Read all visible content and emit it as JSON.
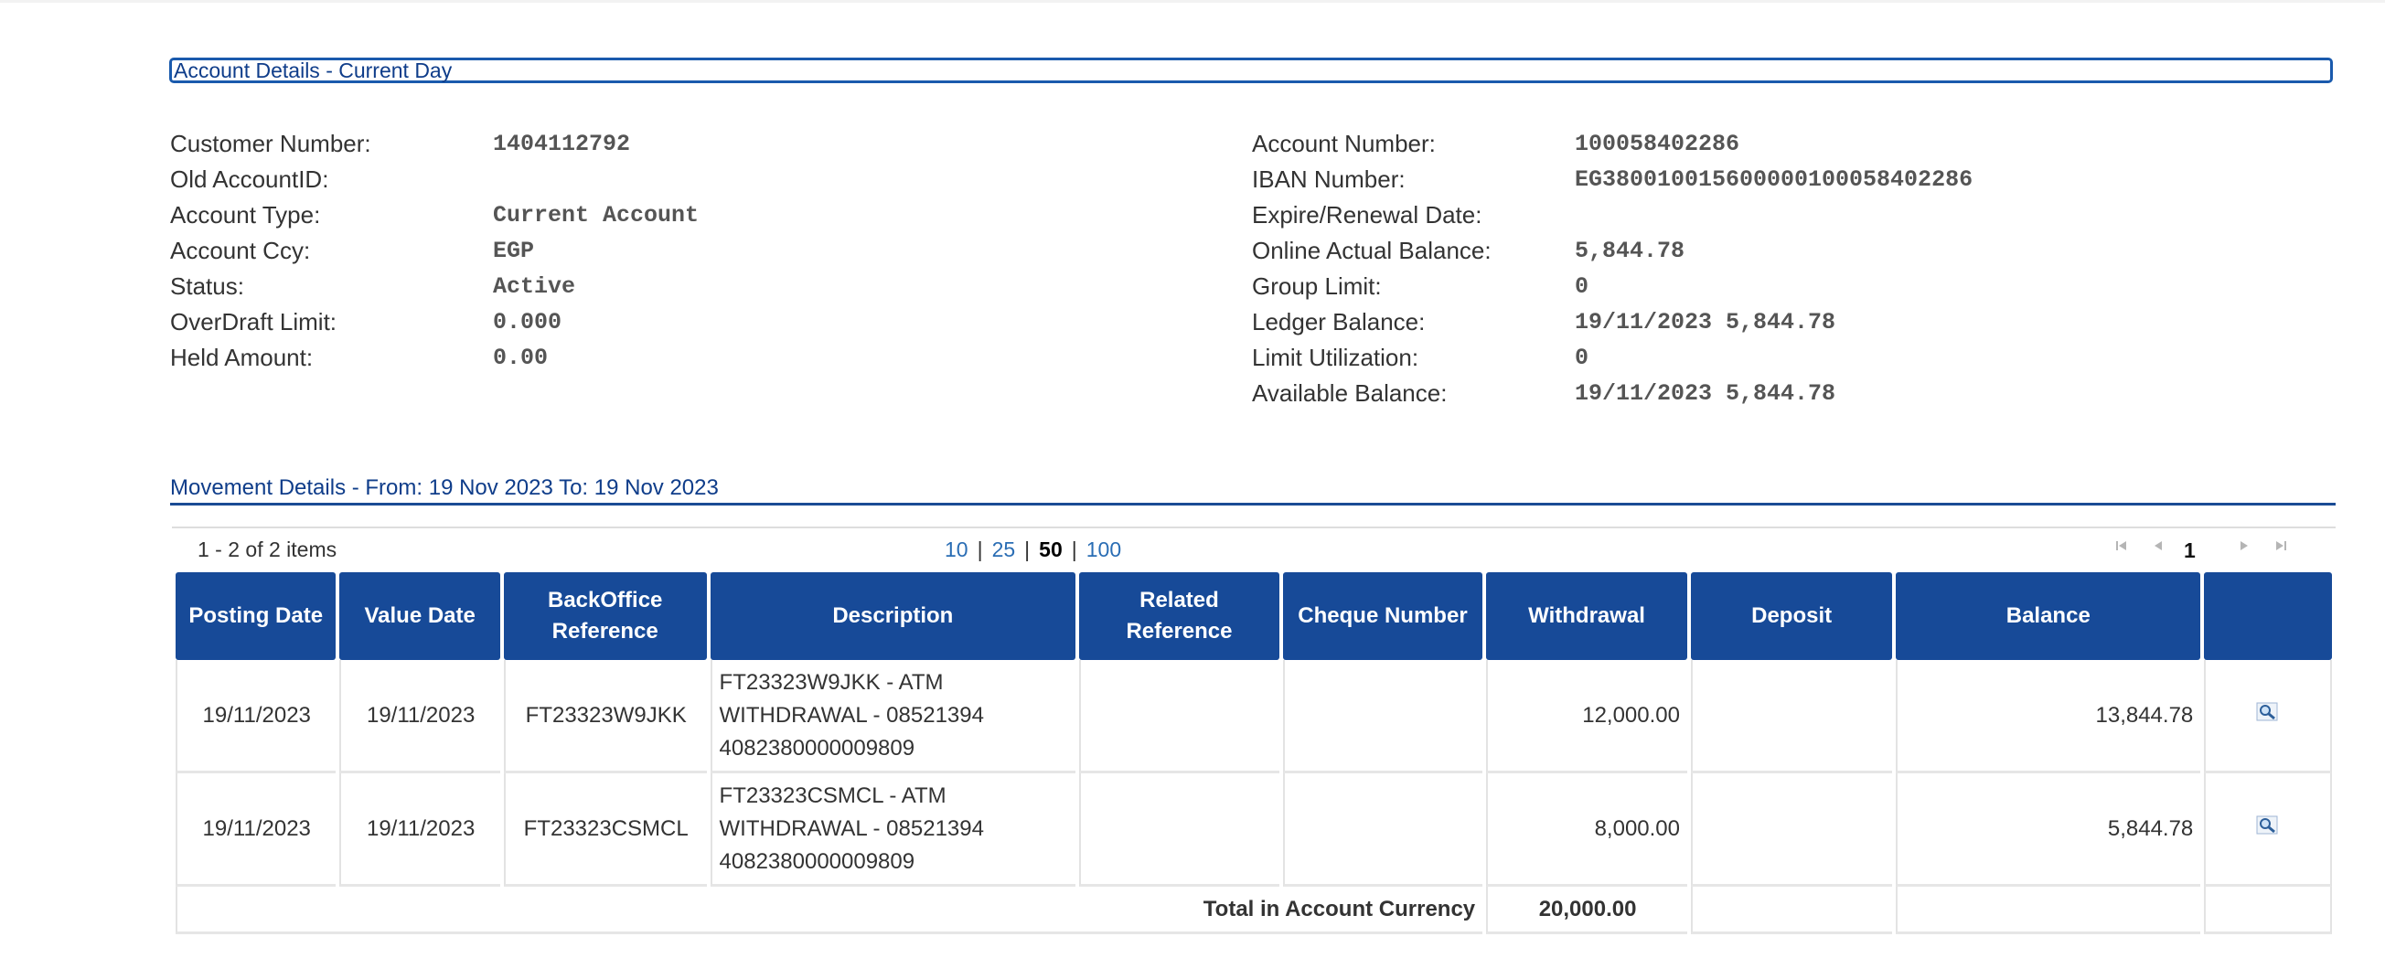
{
  "account_section": {
    "title": "Account Details - Current Day"
  },
  "account_left": [
    {
      "label": "Customer Number:",
      "value": "1404112792"
    },
    {
      "label": "Old AccountID:",
      "value": ""
    },
    {
      "label": "Account Type:",
      "value": "Current Account"
    },
    {
      "label": "Account Ccy:",
      "value": "EGP"
    },
    {
      "label": "Status:",
      "value": "Active"
    },
    {
      "label": "OverDraft Limit:",
      "value": "0.000"
    },
    {
      "label": "Held Amount:",
      "value": "0.00"
    }
  ],
  "account_right": [
    {
      "label": "Account Number:",
      "value": "100058402286"
    },
    {
      "label": "IBAN Number:",
      "value": "EG380010015600000100058402286"
    },
    {
      "label": "Expire/Renewal Date:",
      "value": ""
    },
    {
      "label": "Online Actual Balance:",
      "value": "5,844.78"
    },
    {
      "label": "Group Limit:",
      "value": "0"
    },
    {
      "label": "Ledger Balance:",
      "value": "19/11/2023 5,844.78"
    },
    {
      "label": "Limit Utilization:",
      "value": "0"
    },
    {
      "label": "Available Balance:",
      "value": "19/11/2023 5,844.78"
    }
  ],
  "movement": {
    "title": "Movement Details - From: 19 Nov 2023 To: 19 Nov 2023",
    "items_count": "1 - 2 of 2 items",
    "page_sizes": [
      "10",
      "25",
      "50",
      "100"
    ],
    "active_page_size": "50",
    "current_page": "1",
    "columns": [
      "Posting Date",
      "Value Date",
      "BackOffice Reference",
      "Description",
      "Related Reference",
      "Cheque Number",
      "Withdrawal",
      "Deposit",
      "Balance",
      ""
    ],
    "rows": [
      {
        "posting_date": "19/11/2023",
        "value_date": "19/11/2023",
        "backoffice_ref": "FT23323W9JKK",
        "description": [
          "FT23323W9JKK - ATM",
          "WITHDRAWAL - 08521394",
          "4082380000009809"
        ],
        "related_ref": "",
        "cheque_number": "",
        "withdrawal": "12,000.00",
        "deposit": "",
        "balance": "13,844.78"
      },
      {
        "posting_date": "19/11/2023",
        "value_date": "19/11/2023",
        "backoffice_ref": "FT23323CSMCL",
        "description": [
          "FT23323CSMCL - ATM",
          "WITHDRAWAL - 08521394",
          "4082380000009809"
        ],
        "related_ref": "",
        "cheque_number": "",
        "withdrawal": "8,000.00",
        "deposit": "",
        "balance": "5,844.78"
      }
    ],
    "total_label": "Total in Account Currency",
    "total_withdrawal": "20,000.00"
  },
  "icons": {
    "first_page": "first-page-icon",
    "prev_page": "prev-page-icon",
    "next_page": "next-page-icon",
    "last_page": "last-page-icon",
    "details": "magnifier-icon"
  },
  "colors": {
    "header_bg": "#174a98",
    "title_text": "#0f3d8a",
    "link": "#2a6db4"
  }
}
